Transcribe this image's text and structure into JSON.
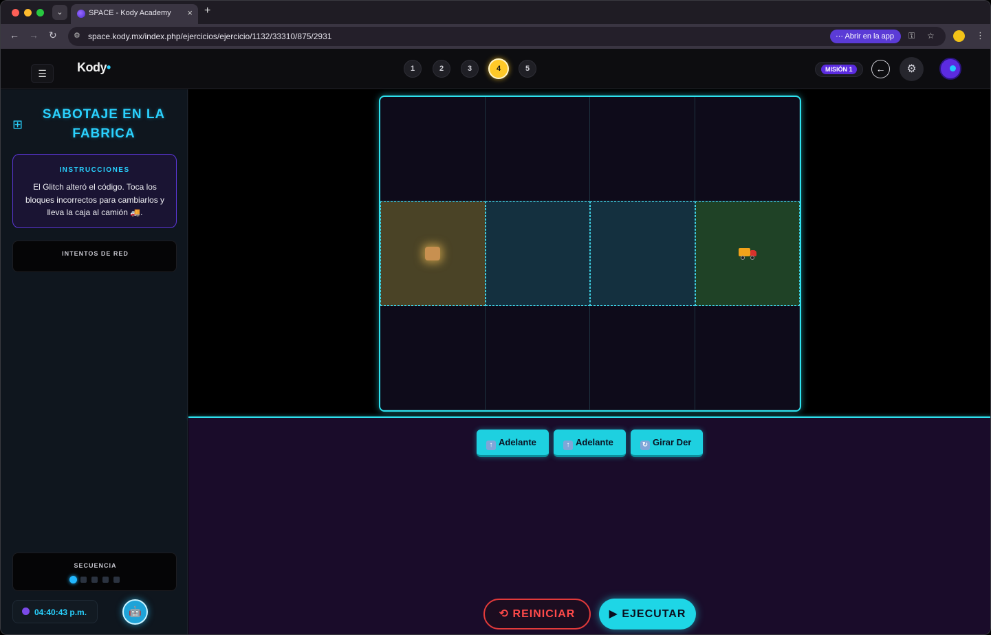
{
  "browser": {
    "tab_title": "SPACE - Kody Academy",
    "url": "space.kody.mx/index.php/ejercicios/ejercicio/1132/33310/875/2931",
    "open_app_label": "Abrir en la app"
  },
  "header": {
    "logo": "Kody",
    "steps": [
      "1",
      "2",
      "3",
      "4",
      "5"
    ],
    "active_step": "4",
    "mission_badge": "MISIÓN 1"
  },
  "sidebar": {
    "title_line1": "SABOTAJE EN LA",
    "title_line2": "FABRICA",
    "instructions_label": "INSTRUCCIONES",
    "instructions_text": "El Glitch alteró el código. Toca los bloques incorrectos para cambiarlos y lleva la caja al camión 🚚.",
    "attempts_label": "INTENTOS DE RED",
    "sequence_label": "SECUENCIA",
    "sequence_total": 5,
    "sequence_current": 1,
    "clock_time": "04:40:43 p.m."
  },
  "board": {
    "rows": 3,
    "cols": 4,
    "path_row": 1,
    "start": {
      "row": 1,
      "col": 0,
      "item": "box"
    },
    "goal": {
      "row": 1,
      "col": 3,
      "item": "truck"
    }
  },
  "code_blocks": [
    {
      "label": "Adelante",
      "icon": "arrow-up-icon"
    },
    {
      "label": "Adelante",
      "icon": "arrow-up-icon"
    },
    {
      "label": "Girar Der",
      "icon": "rotate-right-icon"
    }
  ],
  "actions": {
    "reset_label": "REINICIAR",
    "run_label": "EJECUTAR"
  },
  "colors": {
    "accent_cyan": "#2ee3f0",
    "start_cell": "#4a4326",
    "path_cell": "#14303f",
    "goal_cell": "#1f4226",
    "active_step": "#ffc928",
    "reset_red": "#e23a3a"
  }
}
